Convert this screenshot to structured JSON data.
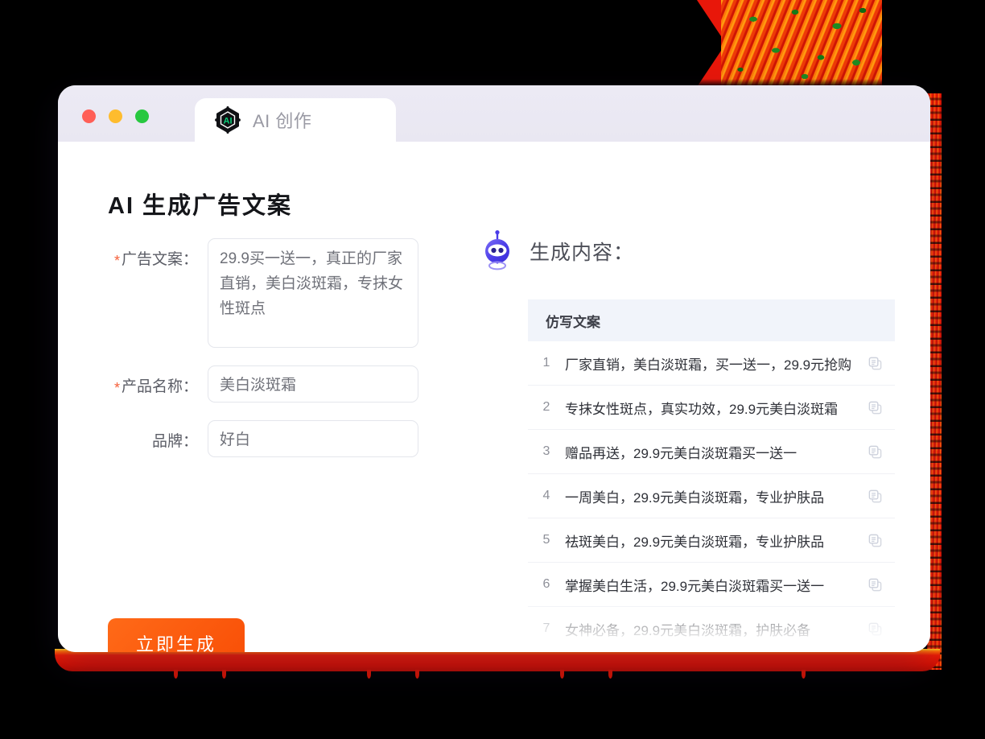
{
  "window": {
    "traffic_lights": [
      {
        "name": "close",
        "color": "#ff5f57"
      },
      {
        "name": "minimize",
        "color": "#febc2e"
      },
      {
        "name": "maximize",
        "color": "#28c840"
      }
    ],
    "tab": {
      "label": "AI 创作",
      "icon": "ai-hexagon-icon",
      "badge_text": "AI",
      "badge_color": "#0bd17a"
    }
  },
  "left_pane": {
    "title": "AI 生成广告文案",
    "fields": [
      {
        "label": "广告文案：",
        "required": true,
        "value": "29.9买一送一，真正的厂家直销，美白淡斑霜，专抹女性斑点",
        "type": "textarea"
      },
      {
        "label": "产品名称：",
        "required": true,
        "value": "美白淡斑霜",
        "type": "text"
      },
      {
        "label": "品牌：",
        "required": false,
        "value": "好白",
        "type": "text"
      }
    ],
    "generate_button": "立即生成",
    "generate_button_color": "#f8540a"
  },
  "right_pane": {
    "title": "生成内容：",
    "robot_icon": "robot-icon",
    "table": {
      "header": "仿写文案",
      "rows": [
        {
          "index": "1",
          "text": "厂家直销，美白淡斑霜，买一送一，29.9元抢购"
        },
        {
          "index": "2",
          "text": "专抹女性斑点，真实功效，29.9元美白淡斑霜"
        },
        {
          "index": "3",
          "text": "赠品再送，29.9元美白淡斑霜买一送一"
        },
        {
          "index": "4",
          "text": "一周美白，29.9元美白淡斑霜，专业护肤品"
        },
        {
          "index": "5",
          "text": "祛斑美白，29.9元美白淡斑霜，专业护肤品"
        },
        {
          "index": "6",
          "text": "掌握美白生活，29.9元美白淡斑霜买一送一"
        },
        {
          "index": "7",
          "text": "女神必备，29.9元美白淡斑霜，护肤必备"
        }
      ],
      "row_action_icon": "copy-icon"
    }
  }
}
